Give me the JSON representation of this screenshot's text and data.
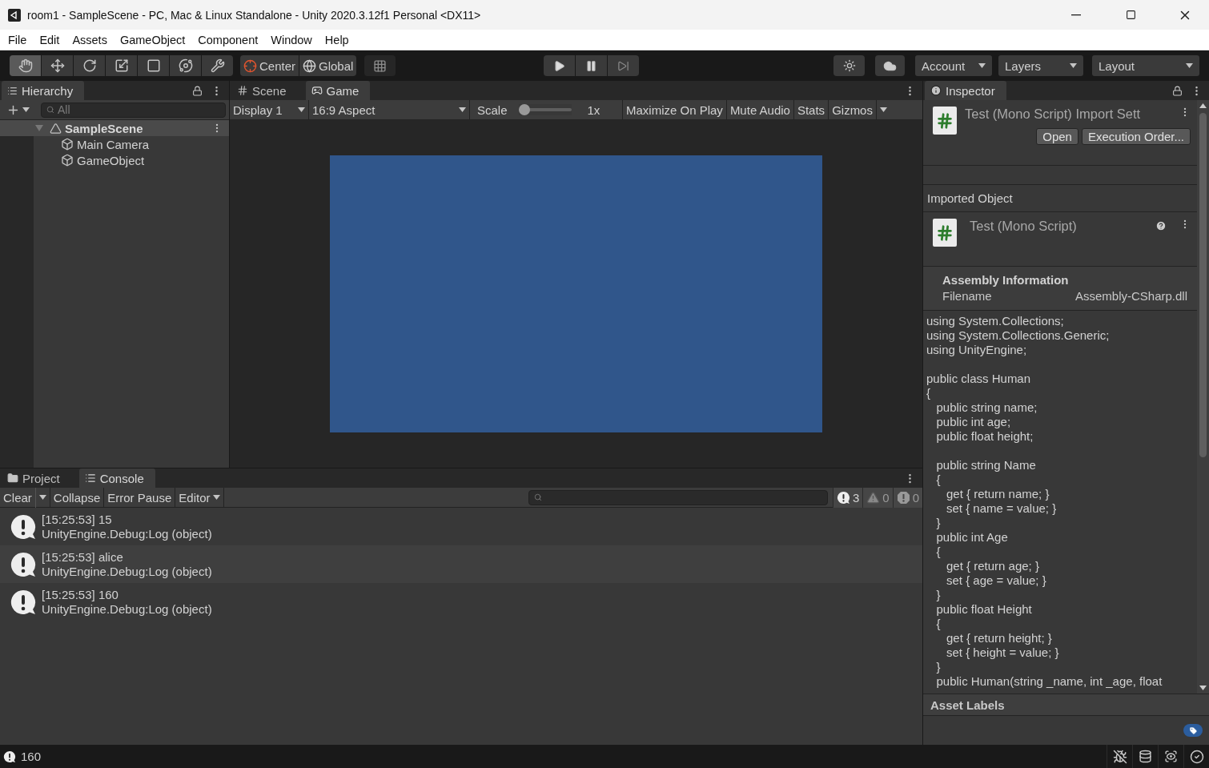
{
  "window": {
    "title": "room1 - SampleScene - PC, Mac & Linux Standalone - Unity 2020.3.12f1 Personal <DX11>"
  },
  "menu": [
    "File",
    "Edit",
    "Assets",
    "GameObject",
    "Component",
    "Window",
    "Help"
  ],
  "toolbar": {
    "tools": [
      {
        "kind": "hand",
        "selected": true
      },
      {
        "kind": "move",
        "selected": false
      },
      {
        "kind": "rotate",
        "selected": false
      },
      {
        "kind": "scale",
        "selected": false
      },
      {
        "kind": "rect",
        "selected": false
      },
      {
        "kind": "transform",
        "selected": false
      },
      {
        "kind": "custom",
        "selected": false
      }
    ],
    "pivot": [
      "Center",
      "Global"
    ],
    "account": "Account",
    "layers": "Layers",
    "layout": "Layout"
  },
  "hierarchy": {
    "tab": "Hierarchy",
    "search_placeholder": "All",
    "tree": [
      {
        "label": "SampleScene",
        "kind": "scene",
        "expanded": true,
        "children": [
          {
            "label": "Main Camera",
            "kind": "object"
          },
          {
            "label": "GameObject",
            "kind": "object"
          }
        ]
      }
    ]
  },
  "game_view": {
    "tabs": [
      {
        "label": "Scene",
        "kind": "scene",
        "selected": false
      },
      {
        "label": "Game",
        "kind": "game",
        "selected": true
      }
    ],
    "display": "Display 1",
    "aspect": "16:9 Aspect",
    "scale_label": "Scale",
    "scale": {
      "level": 0
    },
    "scale_value": "1x",
    "toggles": [
      "Maximize On Play",
      "Mute Audio",
      "Stats",
      "Gizmos"
    ]
  },
  "inspector": {
    "tab": "Inspector",
    "title": "Test (Mono Script) Import Sett",
    "buttons": [
      "Open",
      "Execution Order..."
    ],
    "imported_object": "Imported Object",
    "script_title": "Test (Mono Script)",
    "assembly_heading": "Assembly Information",
    "filename_label": "Filename",
    "filename_value": "Assembly-CSharp.dll",
    "code": "using System.Collections;\nusing System.Collections.Generic;\nusing UnityEngine;\n\npublic class Human\n{\n   public string name;\n   public int age;\n   public float height;\n\n   public string Name\n   {\n      get { return name; }\n      set { name = value; }\n   }\n   public int Age\n   {\n      get { return age; }\n      set { age = value; }\n   }\n   public float Height\n   {\n      get { return height; }\n      set { height = value; }\n   }\n   public Human(string _name, int _age, float",
    "asset_labels": "Asset Labels"
  },
  "console": {
    "tabs": [
      {
        "label": "Project",
        "kind": "project",
        "selected": false
      },
      {
        "label": "Console",
        "kind": "console",
        "selected": true
      }
    ],
    "buttons": [
      "Clear",
      "Collapse",
      "Error Pause",
      "Editor"
    ],
    "counts": [
      {
        "kind": "log",
        "count": "3"
      },
      {
        "kind": "warning",
        "count": "0"
      },
      {
        "kind": "error",
        "count": "0"
      }
    ],
    "entries": [
      {
        "message": "[15:25:53] 15",
        "source": "UnityEngine.Debug:Log (object)"
      },
      {
        "message": "[15:25:53] alice",
        "source": "UnityEngine.Debug:Log (object)"
      },
      {
        "message": "[15:25:53] 160",
        "source": "UnityEngine.Debug:Log (object)"
      }
    ]
  },
  "status_bar": {
    "message": "160"
  }
}
